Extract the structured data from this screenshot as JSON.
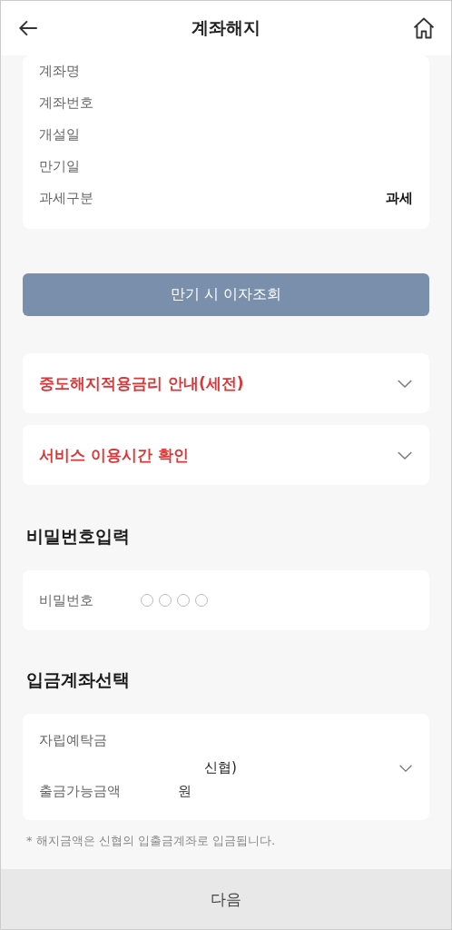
{
  "header": {
    "title": "계좌해지"
  },
  "account_info": {
    "rows": [
      {
        "label": "계좌명",
        "value": ""
      },
      {
        "label": "계좌번호",
        "value": ""
      },
      {
        "label": "개설일",
        "value": ""
      },
      {
        "label": "만기일",
        "value": ""
      },
      {
        "label": "과세구분",
        "value": "과세"
      }
    ]
  },
  "interest_button": {
    "label": "만기 시 이자조회"
  },
  "accordions": [
    {
      "title": "중도해지적용금리 안내(세전)",
      "expanded": false
    },
    {
      "title": "서비스 이용시간 확인",
      "expanded": false
    }
  ],
  "password_section": {
    "heading": "비밀번호입력",
    "label": "비밀번호",
    "digits": [
      {
        "filled": false
      },
      {
        "filled": false
      },
      {
        "filled": false
      },
      {
        "filled": false
      }
    ]
  },
  "deposit_section": {
    "heading": "입금계좌선택",
    "account_name": "자립예탁금",
    "bank": "신협)",
    "balance_label": "출금가능금액",
    "balance_unit": "원",
    "note": "* 해지금액은 신협의 입출금계좌로 입금됩니다."
  },
  "footer": {
    "button": "다음"
  }
}
